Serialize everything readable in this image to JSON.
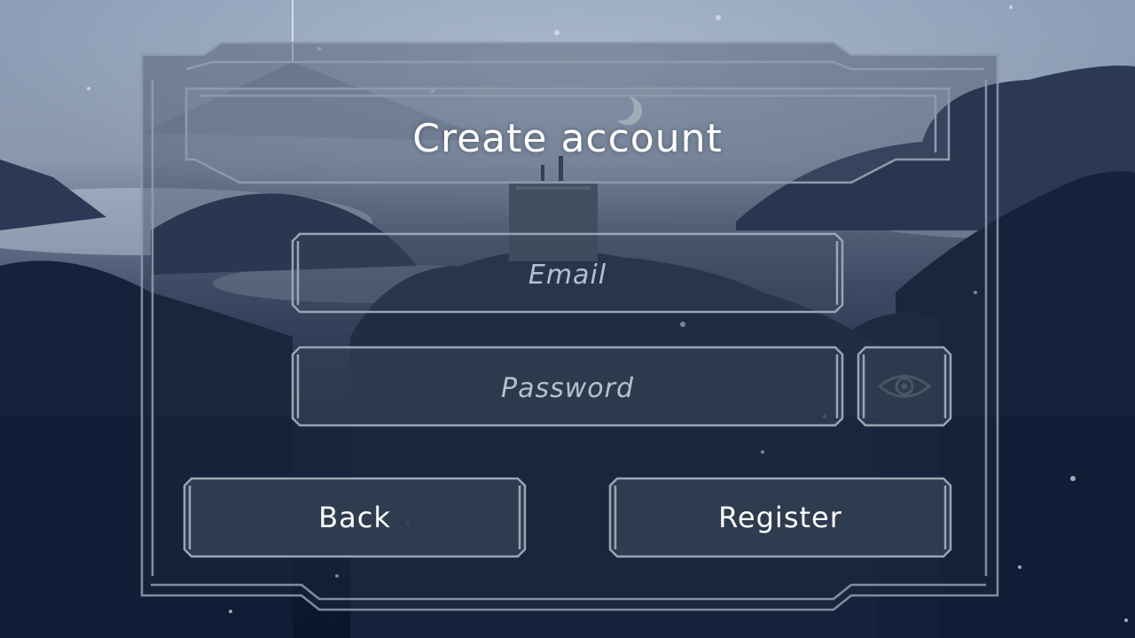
{
  "screen": {
    "title": "Create account"
  },
  "form": {
    "email": {
      "placeholder": "Email",
      "value": ""
    },
    "password": {
      "placeholder": "Password",
      "value": ""
    }
  },
  "actions": {
    "back_label": "Back",
    "register_label": "Register",
    "toggle_visibility_icon": "eye-icon"
  },
  "theme": {
    "panel_border": "#8b96a6",
    "panel_fill": "#2a3547",
    "text": "#ffffff",
    "placeholder": "#b7c0cf"
  }
}
